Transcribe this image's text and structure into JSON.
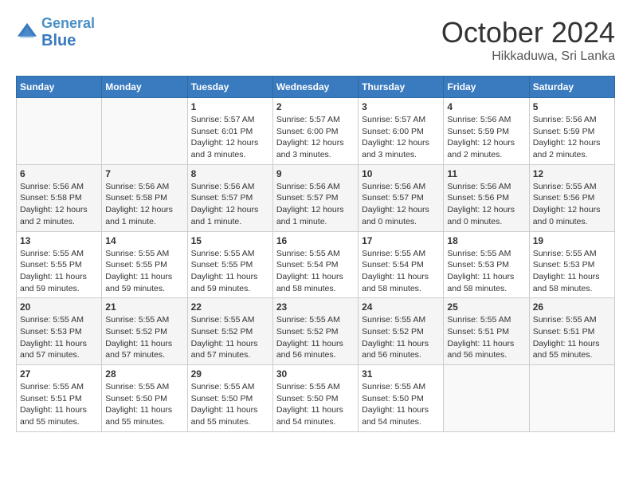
{
  "header": {
    "logo_line1": "General",
    "logo_line2": "Blue",
    "month": "October 2024",
    "location": "Hikkaduwa, Sri Lanka"
  },
  "weekdays": [
    "Sunday",
    "Monday",
    "Tuesday",
    "Wednesday",
    "Thursday",
    "Friday",
    "Saturday"
  ],
  "weeks": [
    [
      {
        "day": "",
        "sunrise": "",
        "sunset": "",
        "daylight": ""
      },
      {
        "day": "",
        "sunrise": "",
        "sunset": "",
        "daylight": ""
      },
      {
        "day": "1",
        "sunrise": "Sunrise: 5:57 AM",
        "sunset": "Sunset: 6:01 PM",
        "daylight": "Daylight: 12 hours and 3 minutes."
      },
      {
        "day": "2",
        "sunrise": "Sunrise: 5:57 AM",
        "sunset": "Sunset: 6:00 PM",
        "daylight": "Daylight: 12 hours and 3 minutes."
      },
      {
        "day": "3",
        "sunrise": "Sunrise: 5:57 AM",
        "sunset": "Sunset: 6:00 PM",
        "daylight": "Daylight: 12 hours and 3 minutes."
      },
      {
        "day": "4",
        "sunrise": "Sunrise: 5:56 AM",
        "sunset": "Sunset: 5:59 PM",
        "daylight": "Daylight: 12 hours and 2 minutes."
      },
      {
        "day": "5",
        "sunrise": "Sunrise: 5:56 AM",
        "sunset": "Sunset: 5:59 PM",
        "daylight": "Daylight: 12 hours and 2 minutes."
      }
    ],
    [
      {
        "day": "6",
        "sunrise": "Sunrise: 5:56 AM",
        "sunset": "Sunset: 5:58 PM",
        "daylight": "Daylight: 12 hours and 2 minutes."
      },
      {
        "day": "7",
        "sunrise": "Sunrise: 5:56 AM",
        "sunset": "Sunset: 5:58 PM",
        "daylight": "Daylight: 12 hours and 1 minute."
      },
      {
        "day": "8",
        "sunrise": "Sunrise: 5:56 AM",
        "sunset": "Sunset: 5:57 PM",
        "daylight": "Daylight: 12 hours and 1 minute."
      },
      {
        "day": "9",
        "sunrise": "Sunrise: 5:56 AM",
        "sunset": "Sunset: 5:57 PM",
        "daylight": "Daylight: 12 hours and 1 minute."
      },
      {
        "day": "10",
        "sunrise": "Sunrise: 5:56 AM",
        "sunset": "Sunset: 5:57 PM",
        "daylight": "Daylight: 12 hours and 0 minutes."
      },
      {
        "day": "11",
        "sunrise": "Sunrise: 5:56 AM",
        "sunset": "Sunset: 5:56 PM",
        "daylight": "Daylight: 12 hours and 0 minutes."
      },
      {
        "day": "12",
        "sunrise": "Sunrise: 5:55 AM",
        "sunset": "Sunset: 5:56 PM",
        "daylight": "Daylight: 12 hours and 0 minutes."
      }
    ],
    [
      {
        "day": "13",
        "sunrise": "Sunrise: 5:55 AM",
        "sunset": "Sunset: 5:55 PM",
        "daylight": "Daylight: 11 hours and 59 minutes."
      },
      {
        "day": "14",
        "sunrise": "Sunrise: 5:55 AM",
        "sunset": "Sunset: 5:55 PM",
        "daylight": "Daylight: 11 hours and 59 minutes."
      },
      {
        "day": "15",
        "sunrise": "Sunrise: 5:55 AM",
        "sunset": "Sunset: 5:55 PM",
        "daylight": "Daylight: 11 hours and 59 minutes."
      },
      {
        "day": "16",
        "sunrise": "Sunrise: 5:55 AM",
        "sunset": "Sunset: 5:54 PM",
        "daylight": "Daylight: 11 hours and 58 minutes."
      },
      {
        "day": "17",
        "sunrise": "Sunrise: 5:55 AM",
        "sunset": "Sunset: 5:54 PM",
        "daylight": "Daylight: 11 hours and 58 minutes."
      },
      {
        "day": "18",
        "sunrise": "Sunrise: 5:55 AM",
        "sunset": "Sunset: 5:53 PM",
        "daylight": "Daylight: 11 hours and 58 minutes."
      },
      {
        "day": "19",
        "sunrise": "Sunrise: 5:55 AM",
        "sunset": "Sunset: 5:53 PM",
        "daylight": "Daylight: 11 hours and 58 minutes."
      }
    ],
    [
      {
        "day": "20",
        "sunrise": "Sunrise: 5:55 AM",
        "sunset": "Sunset: 5:53 PM",
        "daylight": "Daylight: 11 hours and 57 minutes."
      },
      {
        "day": "21",
        "sunrise": "Sunrise: 5:55 AM",
        "sunset": "Sunset: 5:52 PM",
        "daylight": "Daylight: 11 hours and 57 minutes."
      },
      {
        "day": "22",
        "sunrise": "Sunrise: 5:55 AM",
        "sunset": "Sunset: 5:52 PM",
        "daylight": "Daylight: 11 hours and 57 minutes."
      },
      {
        "day": "23",
        "sunrise": "Sunrise: 5:55 AM",
        "sunset": "Sunset: 5:52 PM",
        "daylight": "Daylight: 11 hours and 56 minutes."
      },
      {
        "day": "24",
        "sunrise": "Sunrise: 5:55 AM",
        "sunset": "Sunset: 5:52 PM",
        "daylight": "Daylight: 11 hours and 56 minutes."
      },
      {
        "day": "25",
        "sunrise": "Sunrise: 5:55 AM",
        "sunset": "Sunset: 5:51 PM",
        "daylight": "Daylight: 11 hours and 56 minutes."
      },
      {
        "day": "26",
        "sunrise": "Sunrise: 5:55 AM",
        "sunset": "Sunset: 5:51 PM",
        "daylight": "Daylight: 11 hours and 55 minutes."
      }
    ],
    [
      {
        "day": "27",
        "sunrise": "Sunrise: 5:55 AM",
        "sunset": "Sunset: 5:51 PM",
        "daylight": "Daylight: 11 hours and 55 minutes."
      },
      {
        "day": "28",
        "sunrise": "Sunrise: 5:55 AM",
        "sunset": "Sunset: 5:50 PM",
        "daylight": "Daylight: 11 hours and 55 minutes."
      },
      {
        "day": "29",
        "sunrise": "Sunrise: 5:55 AM",
        "sunset": "Sunset: 5:50 PM",
        "daylight": "Daylight: 11 hours and 55 minutes."
      },
      {
        "day": "30",
        "sunrise": "Sunrise: 5:55 AM",
        "sunset": "Sunset: 5:50 PM",
        "daylight": "Daylight: 11 hours and 54 minutes."
      },
      {
        "day": "31",
        "sunrise": "Sunrise: 5:55 AM",
        "sunset": "Sunset: 5:50 PM",
        "daylight": "Daylight: 11 hours and 54 minutes."
      },
      {
        "day": "",
        "sunrise": "",
        "sunset": "",
        "daylight": ""
      },
      {
        "day": "",
        "sunrise": "",
        "sunset": "",
        "daylight": ""
      }
    ]
  ]
}
